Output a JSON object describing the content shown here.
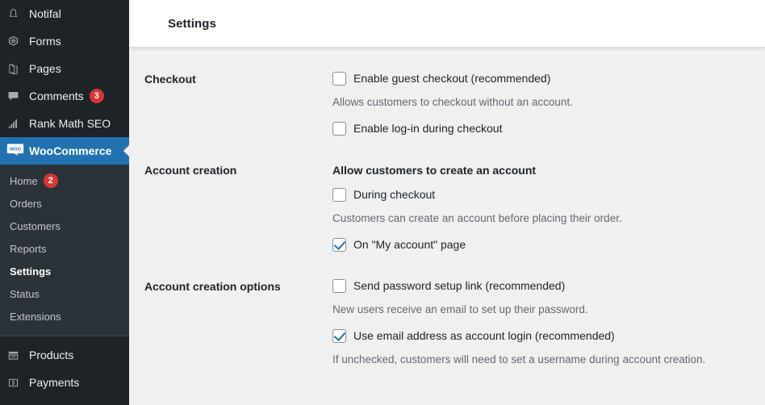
{
  "sidebar": {
    "top_items": [
      {
        "label": "Notifal",
        "icon": "bell-icon",
        "badge": null
      },
      {
        "label": "Forms",
        "icon": "forms-icon",
        "badge": null
      },
      {
        "label": "Pages",
        "icon": "pages-icon",
        "badge": null
      },
      {
        "label": "Comments",
        "icon": "comments-icon",
        "badge": "3"
      },
      {
        "label": "Rank Math SEO",
        "icon": "chart-bars-icon",
        "badge": null
      }
    ],
    "current_item": {
      "label": "WooCommerce",
      "icon": "woocommerce-icon"
    },
    "submenu": [
      {
        "label": "Home",
        "badge": "2",
        "current": false
      },
      {
        "label": "Orders",
        "badge": null,
        "current": false
      },
      {
        "label": "Customers",
        "badge": null,
        "current": false
      },
      {
        "label": "Reports",
        "badge": null,
        "current": false
      },
      {
        "label": "Settings",
        "badge": null,
        "current": true
      },
      {
        "label": "Status",
        "badge": null,
        "current": false
      },
      {
        "label": "Extensions",
        "badge": null,
        "current": false
      }
    ],
    "bottom_items": [
      {
        "label": "Products",
        "icon": "products-icon",
        "badge": null
      },
      {
        "label": "Payments",
        "icon": "payments-icon",
        "badge": null
      }
    ]
  },
  "header": {
    "title": "Settings"
  },
  "sections": [
    {
      "label": "Checkout",
      "heading": null,
      "fields": [
        {
          "type": "checkbox",
          "label": "Enable guest checkout (recommended)",
          "checked": false
        },
        {
          "type": "help",
          "text": "Allows customers to checkout without an account."
        },
        {
          "type": "checkbox",
          "label": "Enable log-in during checkout",
          "checked": false
        }
      ]
    },
    {
      "label": "Account creation",
      "heading": "Allow customers to create an account",
      "fields": [
        {
          "type": "checkbox",
          "label": "During checkout",
          "checked": false
        },
        {
          "type": "help",
          "text": "Customers can create an account before placing their order."
        },
        {
          "type": "checkbox",
          "label": "On \"My account\" page",
          "checked": true
        }
      ]
    },
    {
      "label": "Account creation options",
      "heading": null,
      "fields": [
        {
          "type": "checkbox",
          "label": "Send password setup link (recommended)",
          "checked": false
        },
        {
          "type": "help",
          "text": "New users receive an email to set up their password."
        },
        {
          "type": "checkbox",
          "label": "Use email address as account login (recommended)",
          "checked": true
        },
        {
          "type": "help",
          "text": "If unchecked, customers will need to set a username during account creation."
        }
      ]
    }
  ],
  "colors": {
    "sidebar_bg": "#1d2327",
    "submenu_bg": "#2c3338",
    "accent_blue": "#2271b1",
    "badge_red": "#d63638",
    "content_bg": "#f0f0f1",
    "header_bg": "#ffffff"
  }
}
